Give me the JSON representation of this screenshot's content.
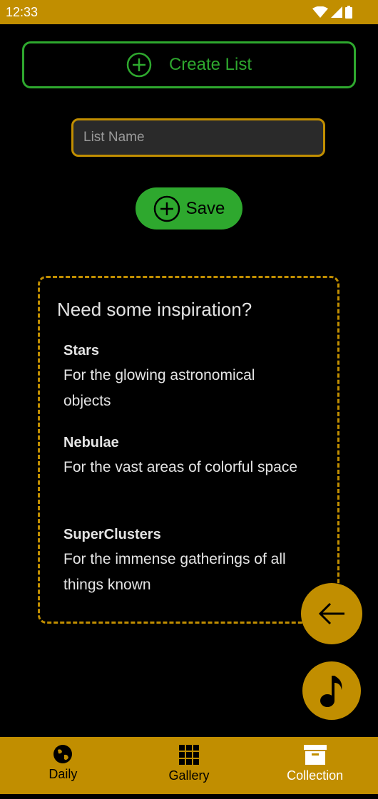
{
  "status_bar": {
    "time": "12:33",
    "icons": [
      "wifi-icon",
      "signal-icon",
      "battery-icon"
    ]
  },
  "create_list": {
    "label": "Create List",
    "icon": "plus-circle-icon"
  },
  "list_name": {
    "placeholder": "List Name",
    "value": ""
  },
  "save": {
    "label": "Save",
    "icon": "plus-circle-icon"
  },
  "inspiration": {
    "heading": "Need some inspiration?",
    "items": [
      {
        "title": "Stars",
        "desc": "For the glowing astronomical objects"
      },
      {
        "title": "Nebulae",
        "desc": "For the vast areas of colorful space"
      },
      {
        "title": "SuperClusters",
        "desc": "For the immense gatherings of all things known"
      }
    ]
  },
  "fabs": {
    "back_icon": "arrow-left-icon",
    "music_icon": "music-note-icon"
  },
  "nav": {
    "items": [
      {
        "label": "Daily",
        "icon": "globe-icon",
        "active": false
      },
      {
        "label": "Gallery",
        "icon": "grid-icon",
        "active": false
      },
      {
        "label": "Collection",
        "icon": "archive-box-icon",
        "active": true
      }
    ]
  },
  "colors": {
    "accent": "#c18e00",
    "green": "#2ea82e",
    "background": "#000000",
    "text": "#e4e4e4"
  }
}
